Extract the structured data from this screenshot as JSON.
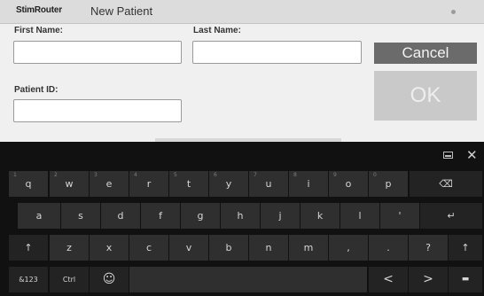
{
  "window": {
    "brand": "StimRouter",
    "title": "New Patient"
  },
  "form": {
    "first_name_label": "First Name:",
    "last_name_label": "Last Name:",
    "patient_id_label": "Patient ID:",
    "first_name_value": "",
    "last_name_value": "",
    "patient_id_value": ""
  },
  "buttons": {
    "cancel": "Cancel",
    "ok": "OK"
  },
  "keyboard": {
    "icons": {
      "close": "close-icon",
      "dock": "keyboard-dock-icon"
    },
    "row1": [
      {
        "label": "q",
        "hint": "1"
      },
      {
        "label": "w",
        "hint": "2"
      },
      {
        "label": "e",
        "hint": "3"
      },
      {
        "label": "r",
        "hint": "4"
      },
      {
        "label": "t",
        "hint": "5"
      },
      {
        "label": "y",
        "hint": "6"
      },
      {
        "label": "u",
        "hint": "7"
      },
      {
        "label": "i",
        "hint": "8"
      },
      {
        "label": "o",
        "hint": "9"
      },
      {
        "label": "p",
        "hint": "0"
      },
      {
        "label": "⌫"
      }
    ],
    "row2": [
      {
        "label": "a"
      },
      {
        "label": "s"
      },
      {
        "label": "d"
      },
      {
        "label": "f"
      },
      {
        "label": "g"
      },
      {
        "label": "h"
      },
      {
        "label": "j"
      },
      {
        "label": "k"
      },
      {
        "label": "l"
      },
      {
        "label": "'"
      },
      {
        "label": "↵"
      }
    ],
    "row3": [
      {
        "label": "↑"
      },
      {
        "label": "z"
      },
      {
        "label": "x"
      },
      {
        "label": "c"
      },
      {
        "label": "v"
      },
      {
        "label": "b"
      },
      {
        "label": "n"
      },
      {
        "label": "m"
      },
      {
        "label": ","
      },
      {
        "label": "."
      },
      {
        "label": "?"
      },
      {
        "label": "↑"
      }
    ],
    "row4": [
      {
        "label": "&123"
      },
      {
        "label": "Ctrl"
      },
      {
        "label": "☺"
      },
      {
        "label": ""
      },
      {
        "label": "<"
      },
      {
        "label": ">"
      },
      {
        "label": "▬"
      }
    ]
  }
}
